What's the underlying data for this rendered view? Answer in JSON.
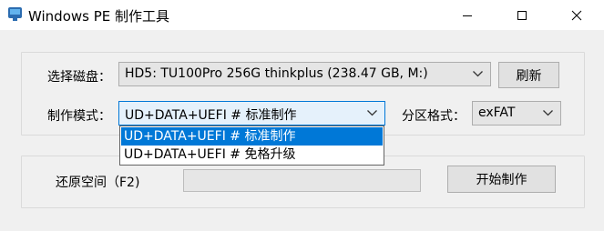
{
  "window": {
    "title": "Windows PE 制作工具",
    "icon": "usb-drive-icon",
    "controls": [
      "minimize-icon",
      "maximize-icon",
      "close-icon"
    ]
  },
  "disk": {
    "label": "选择磁盘：",
    "selected": "HD5: TU100Pro 256G thinkplus (238.47 GB, M:)",
    "refresh_label": "刷新"
  },
  "mode": {
    "label": "制作模式：",
    "selected": "UD+DATA+UEFI # 标准制作",
    "options": [
      {
        "label": "UD+DATA+UEFI # 标准制作",
        "selected": true
      },
      {
        "label": "UD+DATA+UEFI # 免格升级",
        "selected": false
      }
    ]
  },
  "partition": {
    "label": "分区格式：",
    "selected": "exFAT"
  },
  "restore": {
    "label": "还原空间（F2)",
    "progress": 0
  },
  "actions": {
    "start_label": "开始制作"
  },
  "colors": {
    "accent": "#0078d7",
    "progress_fill": "#06b025"
  }
}
